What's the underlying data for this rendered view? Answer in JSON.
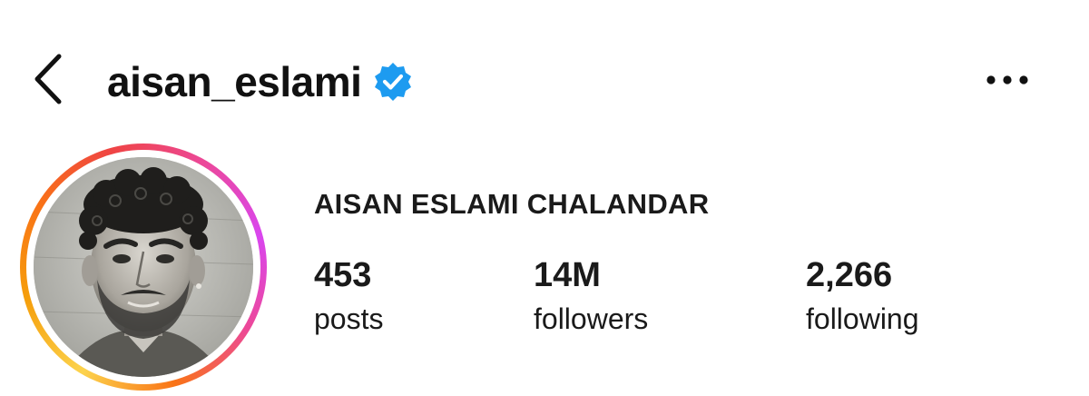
{
  "header": {
    "back_icon": "chevron-left-icon",
    "username": "aisan_eslami",
    "verified_icon": "verified-badge-icon",
    "verified_color": "#1d9bf0",
    "more_icon": "more-horizontal-icon"
  },
  "profile": {
    "full_name": "AISAN ESLAMI CHALANDAR",
    "avatar_ring_colors": [
      "#fcd34d",
      "#f97316",
      "#ec4899",
      "#d946ef"
    ]
  },
  "stats": [
    {
      "value": "453",
      "label": "posts"
    },
    {
      "value": "14M",
      "label": "followers"
    },
    {
      "value": "2,266",
      "label": "following"
    }
  ]
}
